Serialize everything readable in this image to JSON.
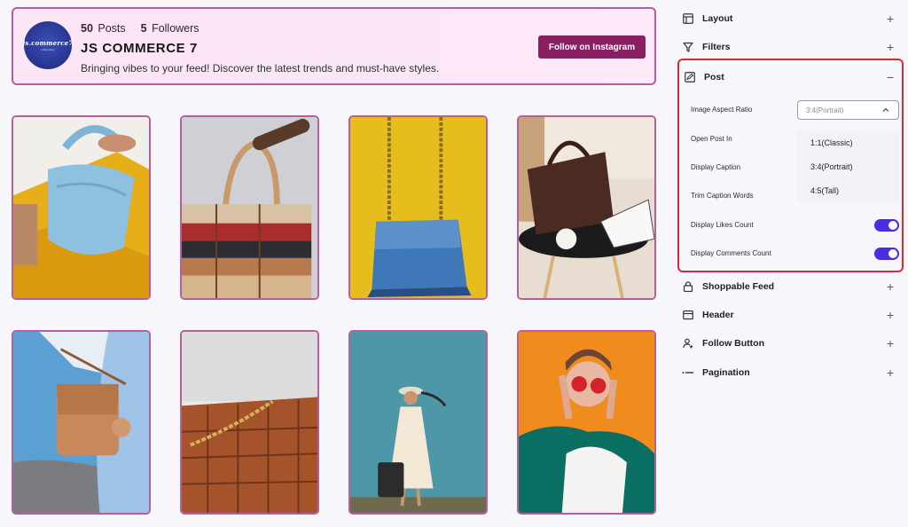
{
  "profile": {
    "logo_text": "js.commerce7",
    "logo_sub": "online shop",
    "posts_count": "50",
    "posts_label": "Posts",
    "followers_count": "5",
    "followers_label": "Followers",
    "name": "JS COMMERCE 7",
    "bio": "Bringing vibes to your feed! Discover the latest trends and must-have styles.",
    "follow_button": "Follow on Instagram",
    "accent": "#8a1e62"
  },
  "grid": {
    "posts": [
      {
        "subject": "blue-ruched-bag-on-yellow"
      },
      {
        "subject": "striped-leather-tote"
      },
      {
        "subject": "blue-chain-bag-on-yellow"
      },
      {
        "subject": "brown-tote-on-side-table"
      },
      {
        "subject": "tan-crossbody-bag-denim"
      },
      {
        "subject": "woven-leather-chain-bag"
      },
      {
        "subject": "woman-in-dress-with-suitcase"
      },
      {
        "subject": "woman-red-sunglasses-orange"
      }
    ]
  },
  "sidebar": {
    "sections_top": [
      {
        "label": "Layout",
        "icon": "layout-icon",
        "toggle": "+"
      },
      {
        "label": "Filters",
        "icon": "filter-icon",
        "toggle": "+"
      }
    ],
    "post": {
      "label": "Post",
      "icon": "post-edit-icon",
      "toggle": "−",
      "aspect_ratio_label": "Image Aspect Ratio",
      "aspect_ratio_value": "3:4(Portrait)",
      "aspect_ratio_options": [
        "1:1(Classic)",
        "3:4(Portrait)",
        "4:5(Tall)"
      ],
      "open_post_in_label": "Open Post In",
      "display_caption_label": "Display Caption",
      "trim_caption_label": "Trim Caption Words",
      "display_likes_label": "Display Likes Count",
      "display_likes_on": true,
      "display_comments_label": "Display Comments Count",
      "display_comments_on": true,
      "switch_color": "#4a2de0",
      "highlight_color": "#d62b36"
    },
    "sections_bottom": [
      {
        "label": "Shoppable Feed",
        "icon": "lock-icon",
        "toggle": "+"
      },
      {
        "label": "Header",
        "icon": "header-icon",
        "toggle": "+"
      },
      {
        "label": "Follow Button",
        "icon": "user-plus-icon",
        "toggle": "+"
      },
      {
        "label": "Pagination",
        "icon": "pagination-icon",
        "toggle": "+"
      }
    ]
  }
}
